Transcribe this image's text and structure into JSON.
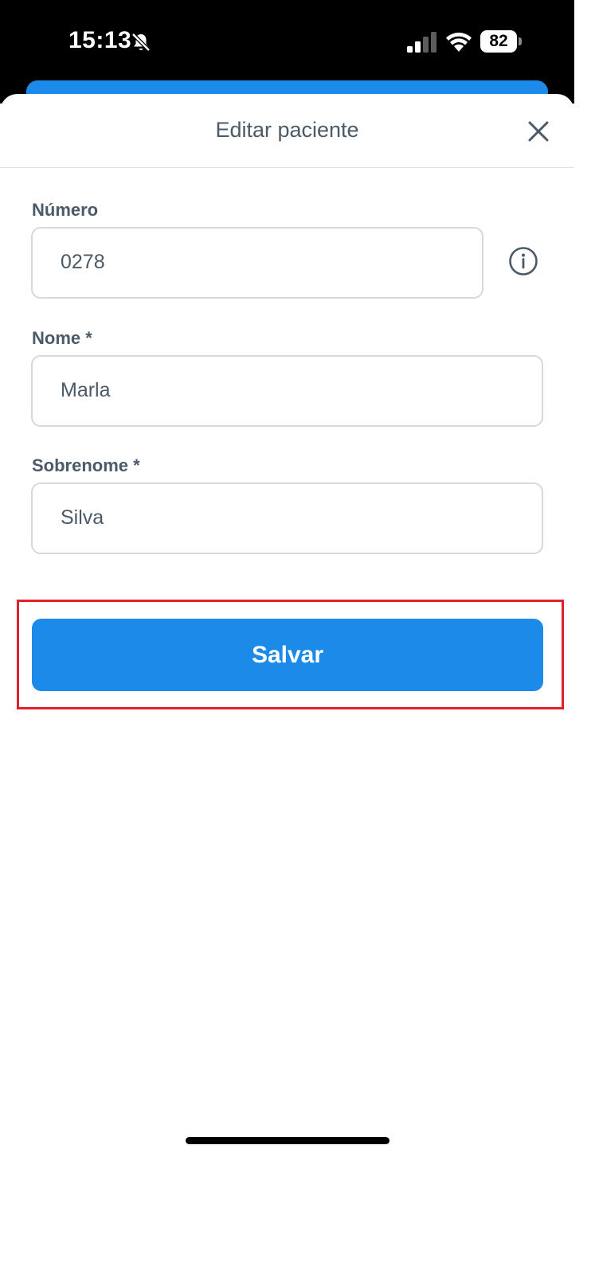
{
  "status_bar": {
    "time": "15:13",
    "battery": "82",
    "icons": [
      "bell-slash-icon",
      "cellular-signal-icon",
      "wifi-icon",
      "battery-icon"
    ]
  },
  "sheet": {
    "title": "Editar paciente",
    "close_icon": "close-icon"
  },
  "form": {
    "numero": {
      "label": "Número",
      "value": "0278",
      "info_icon": "info-icon"
    },
    "nome": {
      "label": "Nome *",
      "value": "Marla"
    },
    "sobrenome": {
      "label": "Sobrenome *",
      "value": "Silva"
    }
  },
  "actions": {
    "save_label": "Salvar"
  },
  "colors": {
    "primary": "#1b8ae8",
    "text": "#4b5a66",
    "border": "#d3d9dd",
    "highlight": "#e0202c"
  }
}
